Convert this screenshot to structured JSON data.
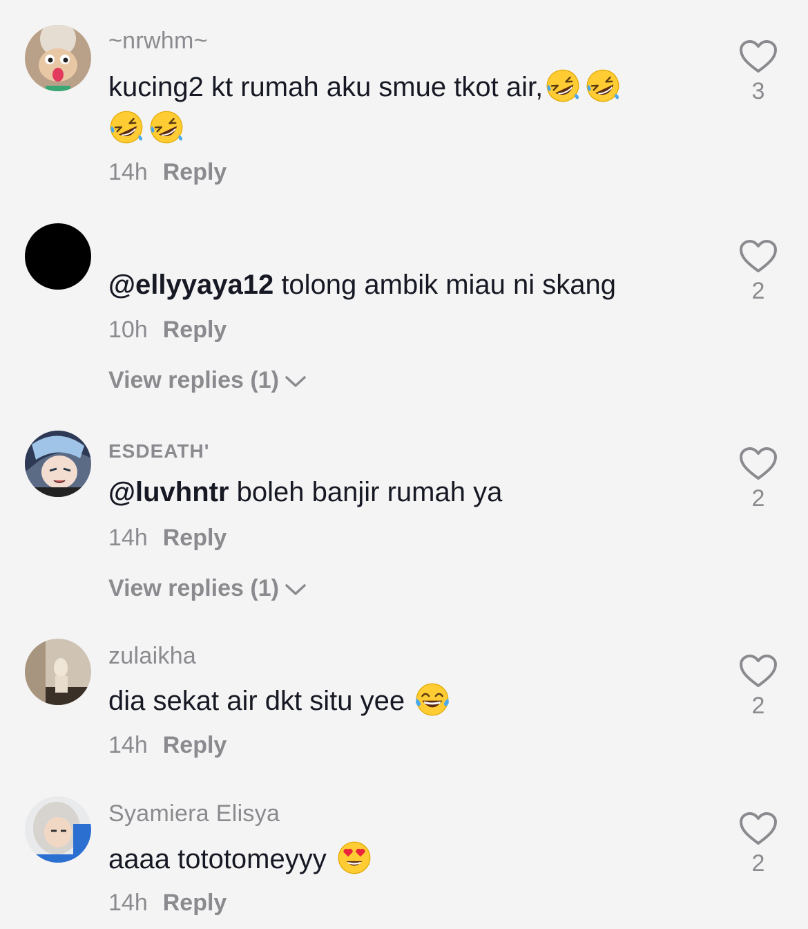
{
  "comments": [
    {
      "username": "~nrwhm~",
      "text": "kucing2 kt rumah aku smue tkot air,",
      "emoji": [
        "rofl-emoji",
        "rofl-emoji",
        "rofl-emoji",
        "rofl-emoji"
      ],
      "time": "14h",
      "reply_label": "Reply",
      "likes": "3"
    },
    {
      "username": "",
      "mention": "@ellyyaya12",
      "text": " tolong ambik miau ni skang",
      "time": "10h",
      "reply_label": "Reply",
      "view_replies": "View replies (1)",
      "likes": "2"
    },
    {
      "username": "ESDEATH'",
      "mention": "@luvhntr",
      "text": " boleh banjir rumah ya",
      "time": "14h",
      "reply_label": "Reply",
      "view_replies": "View replies (1)",
      "likes": "2"
    },
    {
      "username": "zulaikha",
      "text": "dia sekat air dkt situ yee ",
      "emoji": [
        "tears-of-joy-emoji"
      ],
      "time": "14h",
      "reply_label": "Reply",
      "likes": "2"
    },
    {
      "username": "Syamiera Elisya",
      "text": "aaaa tototomeyyy ",
      "emoji": [
        "heart-eyes-emoji"
      ],
      "time": "14h",
      "reply_label": "Reply",
      "likes": "2"
    }
  ],
  "icons": {
    "like": "heart-outline-icon",
    "expand": "chevron-down-icon"
  },
  "colors": {
    "background": "#f4f4f4",
    "text": "#161823",
    "muted": "#8a8a8f"
  }
}
